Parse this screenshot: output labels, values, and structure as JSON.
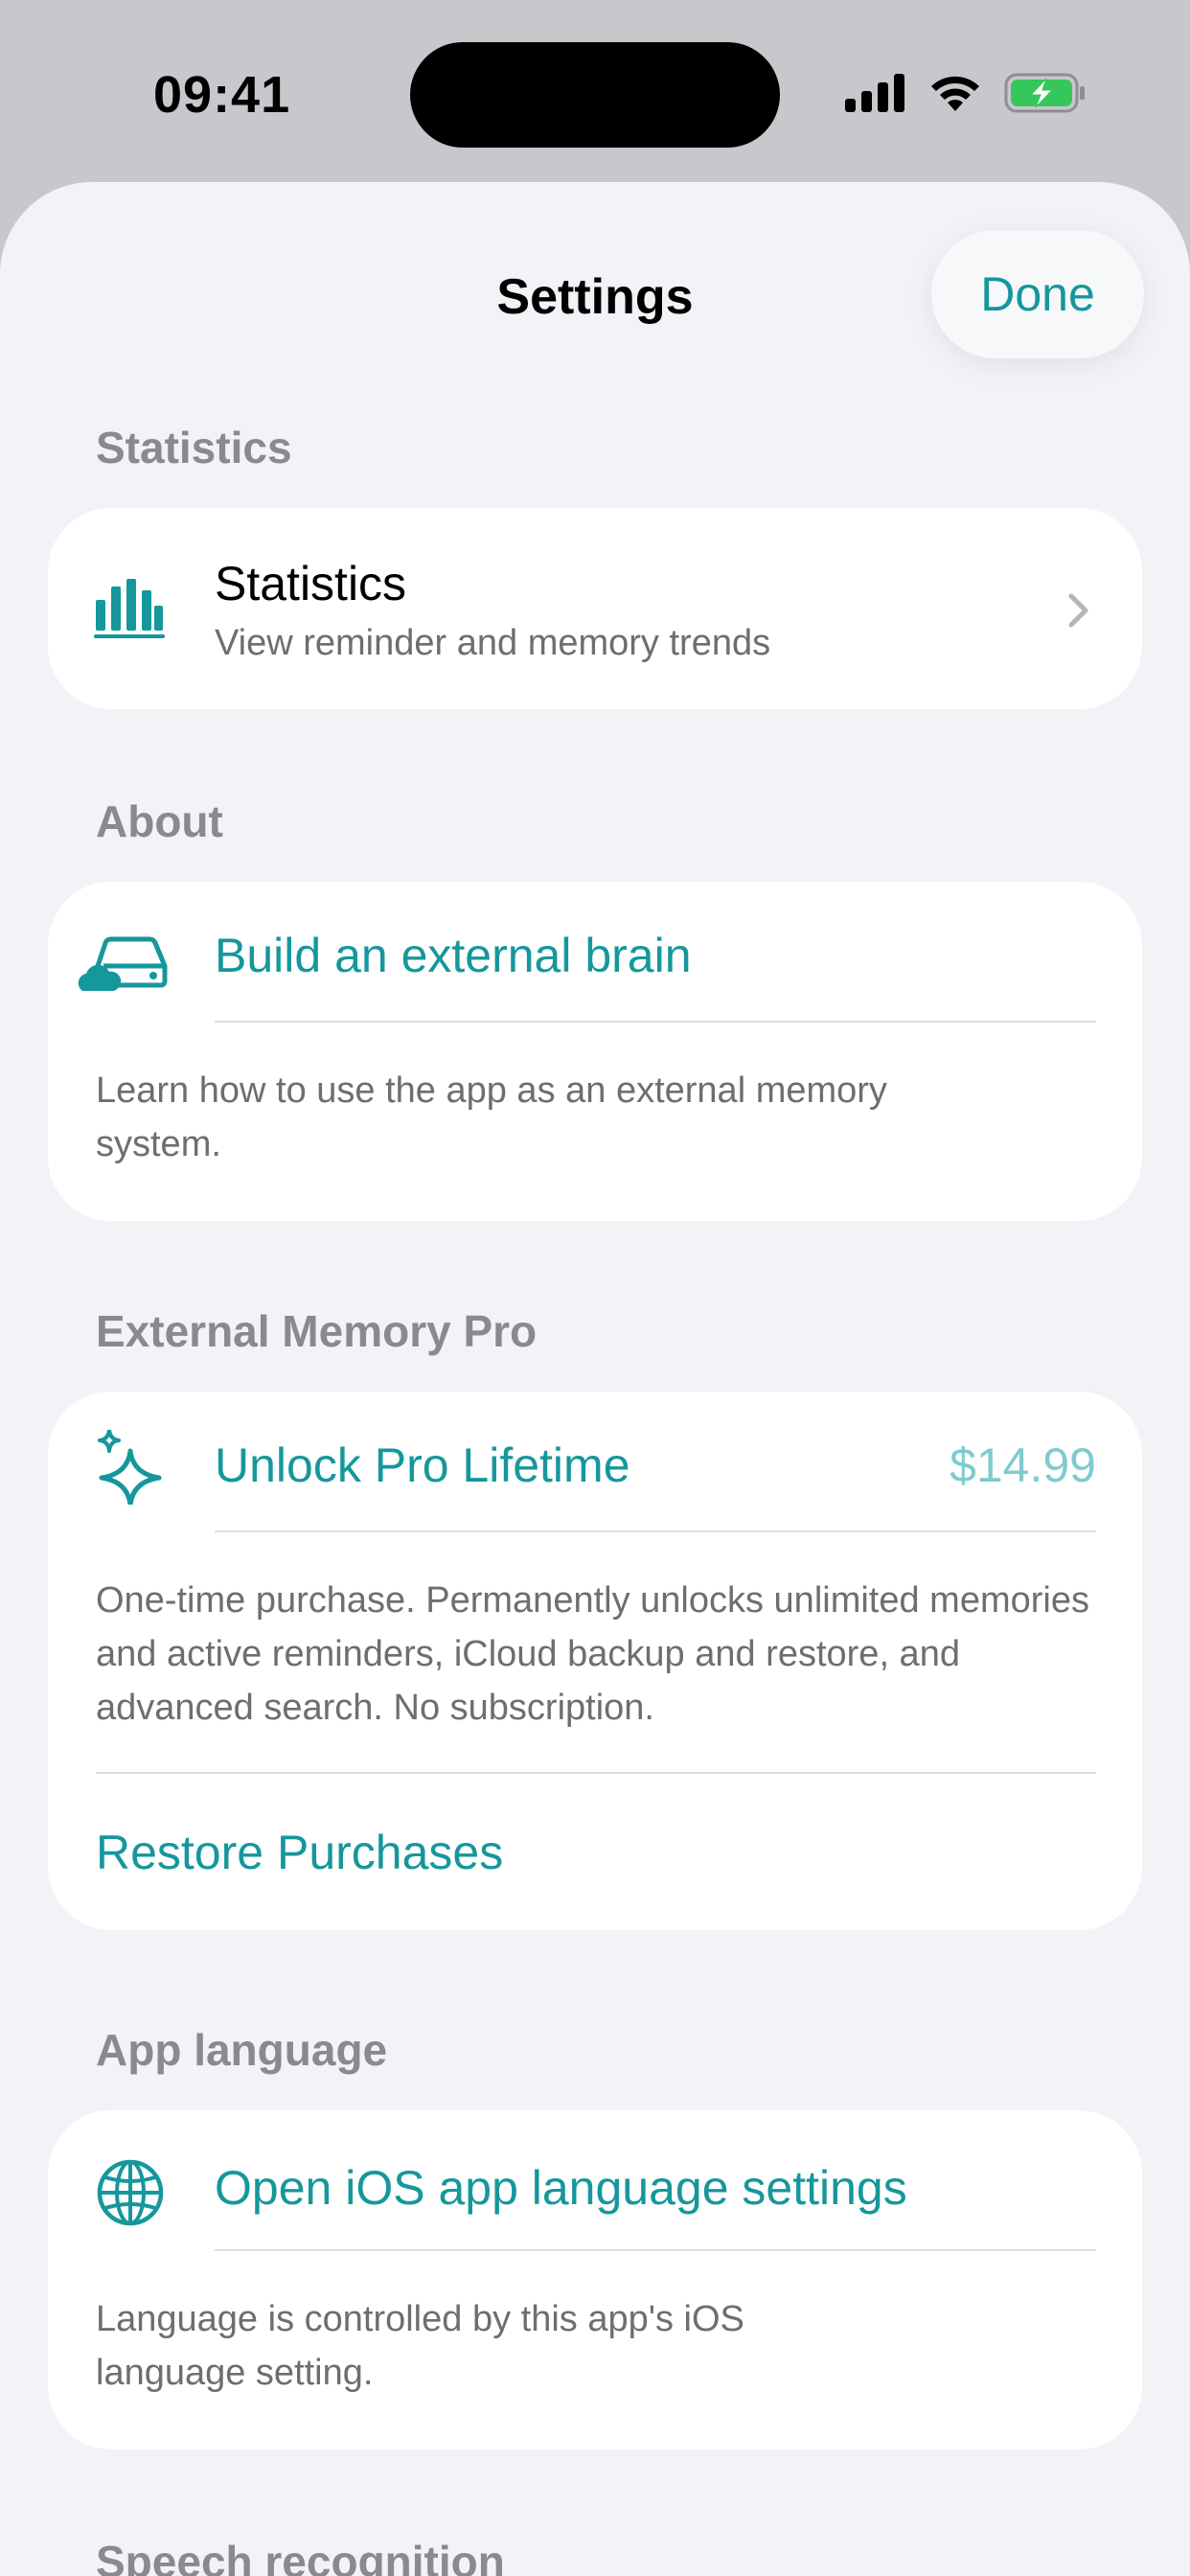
{
  "status_bar": {
    "time": "09:41"
  },
  "nav": {
    "title": "Settings",
    "done_label": "Done"
  },
  "sections": {
    "statistics": {
      "header": "Statistics",
      "row_title": "Statistics",
      "row_subtitle": "View reminder and memory trends"
    },
    "about": {
      "header": "About",
      "row_title": "Build an external brain",
      "description": "Learn how to use the app as an external memory system."
    },
    "pro": {
      "header": "External Memory Pro",
      "row_title": "Unlock Pro Lifetime",
      "price": "$14.99",
      "description": "One-time purchase. Permanently unlocks unlimited memories and active reminders, iCloud backup and restore, and advanced search. No subscription.",
      "restore_label": "Restore Purchases"
    },
    "language": {
      "header": "App language",
      "row_title": "Open iOS app language settings",
      "description": "Language is controlled by this app's iOS language setting."
    },
    "speech": {
      "header": "Speech recognition"
    }
  },
  "colors": {
    "accent": "#15979c",
    "background": "#f2f2f7",
    "card": "#ffffff",
    "secondary_text": "#8a8a8e"
  },
  "icons": [
    "chart-bar-icon",
    "car-cloud-icon",
    "sparkles-icon",
    "globe-icon",
    "chevron-right-icon",
    "signal-icon",
    "wifi-icon",
    "battery-charging-icon"
  ]
}
